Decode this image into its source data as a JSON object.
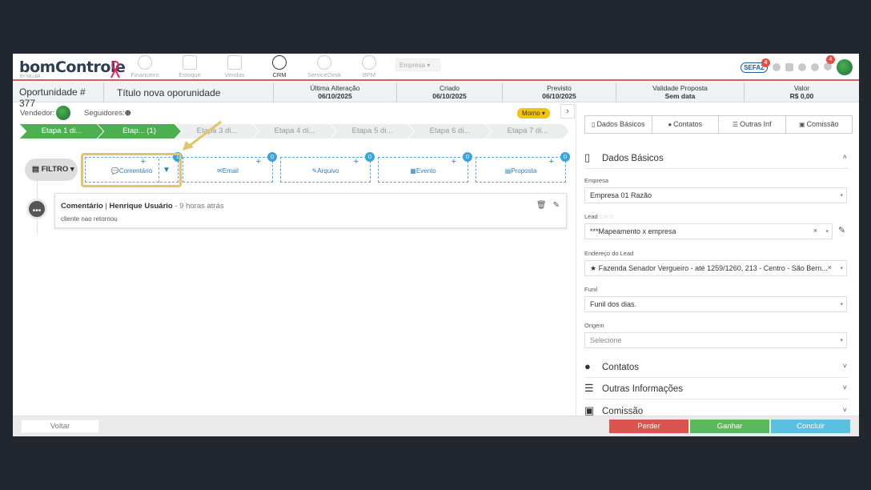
{
  "brand": {
    "logo": "bomControle",
    "logo_sub": "BY NILLER"
  },
  "nav": [
    {
      "label": "Financeiro",
      "icon": "dollar-circle-icon"
    },
    {
      "label": "Estoque",
      "icon": "box-icon"
    },
    {
      "label": "Vendas",
      "icon": "cart-icon"
    },
    {
      "label": "CRM",
      "icon": "target-icon"
    },
    {
      "label": "ServiceDesk",
      "icon": "headset-icon"
    },
    {
      "label": "BPM",
      "icon": "network-icon"
    }
  ],
  "empresa_select": "Empresa",
  "topbar": {
    "sefaz_label": "SEFAZ",
    "sefaz_badge": "4",
    "bell_badge": "4"
  },
  "header": {
    "opportunity": "Oportunidade # 377",
    "name": "Título nova oporunidade",
    "cols": [
      {
        "label": "Última Alteração",
        "value": "06/10/2025"
      },
      {
        "label": "Criado",
        "value": "06/10/2025"
      },
      {
        "label": "Previsto",
        "value": "06/10/2025"
      },
      {
        "label": "Validade Proposta",
        "value": "Sem data"
      },
      {
        "label": "Valor",
        "value": "R$ 0,00"
      }
    ]
  },
  "people": {
    "vendedor_label": "Vendedor:",
    "seguidores_label": "Seguidores:",
    "temperature": "Morno"
  },
  "stages": [
    "Etapa 1 di...",
    "Etap... (1)",
    "Etapa 3 di...",
    "Etapa 4 di...",
    "Etapa 5 di...",
    "Etapa 6 di...",
    "Etapa 7 di..."
  ],
  "toolbar": {
    "filtro": "FILTRO",
    "actions": [
      {
        "label": "Comentário",
        "count": "1"
      },
      {
        "label": "Email",
        "count": "0"
      },
      {
        "label": "Arquivo",
        "count": "0"
      },
      {
        "label": "Evento",
        "count": "0"
      },
      {
        "label": "Proposta",
        "count": "0"
      }
    ]
  },
  "timeline": {
    "type": "Comentário",
    "author": "Henrique Usuário",
    "time": "- 9 horas atrás",
    "body": "cliente nao retornou"
  },
  "right_tabs": [
    "Dados Básicos",
    "Contatos",
    "Outras Inf",
    "Comissão"
  ],
  "dados": {
    "title": "Dados Básicos",
    "fields": {
      "empresa_label": "Empresa",
      "empresa_value": "Empresa 01 Razão",
      "lead_label": "Lead",
      "lead_value": "***Mapeamento x empresa",
      "endereco_label": "Endereço do Lead",
      "endereco_value": "★ Fazenda Senador Vergueiro - até 1259/1260, 213 - Centro - São Bern...",
      "funil_label": "Funil",
      "funil_value": "Funil dos dias.",
      "origem_label": "Origem",
      "origem_value": "Selecione"
    }
  },
  "sections": [
    "Contatos",
    "Outras Informações",
    "Comissão"
  ],
  "footer": {
    "voltar": "Voltar",
    "perder": "Perder",
    "ganhar": "Ganhar",
    "concluir": "Concluir"
  },
  "colors": {
    "green": "#4cb050",
    "red": "#e05a5a",
    "blue": "#5bc0de",
    "highlight": "#e1c46b"
  }
}
